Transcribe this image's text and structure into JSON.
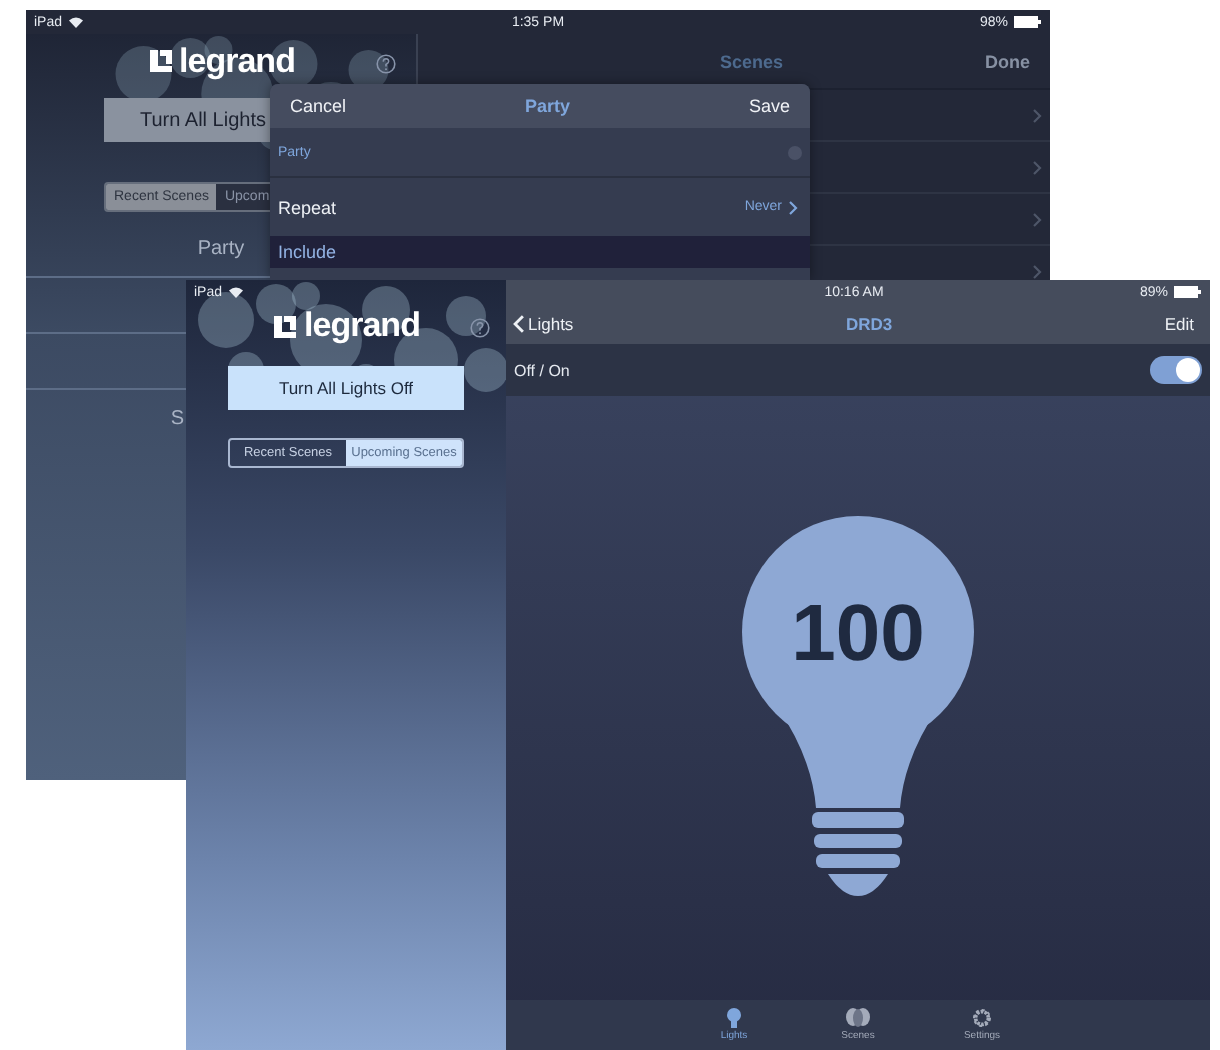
{
  "back_screen": {
    "status_bar": {
      "device": "iPad",
      "time": "1:35 PM",
      "battery": "98%"
    },
    "sidebar": {
      "logo": "legrand",
      "all_lights_button": "Turn All Lights",
      "segments": [
        {
          "label": "Recent Scenes",
          "selected": true
        },
        {
          "label": "Upcom",
          "selected": false
        }
      ],
      "scenes": [
        "Party",
        "S"
      ]
    },
    "nav_bar": {
      "title": "Scenes",
      "done": "Done"
    },
    "modal": {
      "cancel": "Cancel",
      "title": "Party",
      "save": "Save",
      "name_field": {
        "value": "Party"
      },
      "repeat": {
        "label": "Repeat",
        "value": "Never"
      },
      "section": "Include"
    }
  },
  "front_screen": {
    "status_bar": {
      "device": "iPad",
      "time": "10:16 AM",
      "battery": "89%"
    },
    "sidebar": {
      "logo": "legrand",
      "all_lights_button": "Turn All Lights Off",
      "segments": [
        {
          "label": "Recent Scenes",
          "selected": false
        },
        {
          "label": "Upcoming Scenes",
          "selected": true
        }
      ]
    },
    "nav_bar": {
      "back": "Lights",
      "title": "DRD3",
      "edit": "Edit"
    },
    "power": {
      "label": "Off / On",
      "on": true
    },
    "brightness": "100",
    "tab_bar": [
      {
        "kind": "bulb",
        "label": "Lights",
        "selected": true
      },
      {
        "kind": "scenes",
        "label": "Scenes",
        "selected": false
      },
      {
        "kind": "gear",
        "label": "Settings",
        "selected": false
      }
    ]
  }
}
